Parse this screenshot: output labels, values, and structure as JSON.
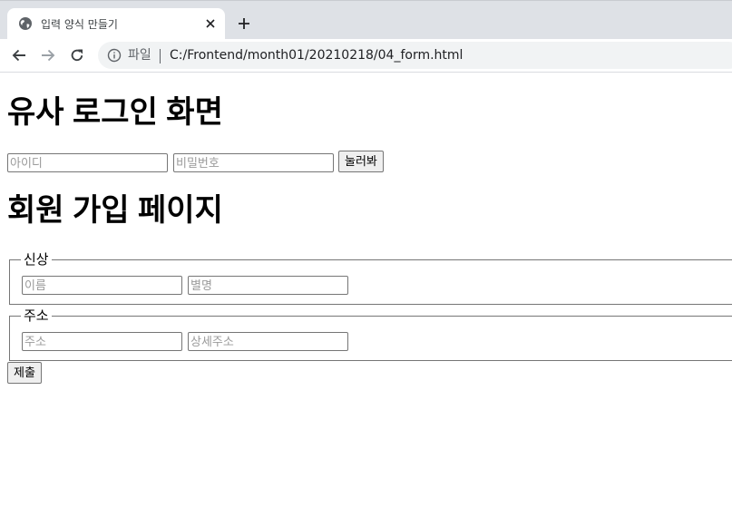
{
  "browser": {
    "tab_title": "입력 양식 만들기",
    "omnibox_chip": "파일",
    "url": "C:/Frontend/month01/20210218/04_form.html",
    "icons": [
      "globe-icon",
      "close-icon",
      "plus-icon",
      "back-arrow-icon",
      "forward-arrow-icon",
      "reload-icon",
      "info-icon"
    ]
  },
  "page": {
    "login": {
      "heading": "유사 로그인 화면",
      "id_placeholder": "아이디",
      "password_placeholder": "비밀번호",
      "button_label": "눌러봐"
    },
    "signup": {
      "heading": "회원 가입 페이지",
      "personal": {
        "legend": "신상",
        "name_placeholder": "이름",
        "nickname_placeholder": "별명"
      },
      "address": {
        "legend": "주소",
        "address_placeholder": "주소",
        "detail_placeholder": "상세주소"
      },
      "submit_label": "제출"
    }
  }
}
